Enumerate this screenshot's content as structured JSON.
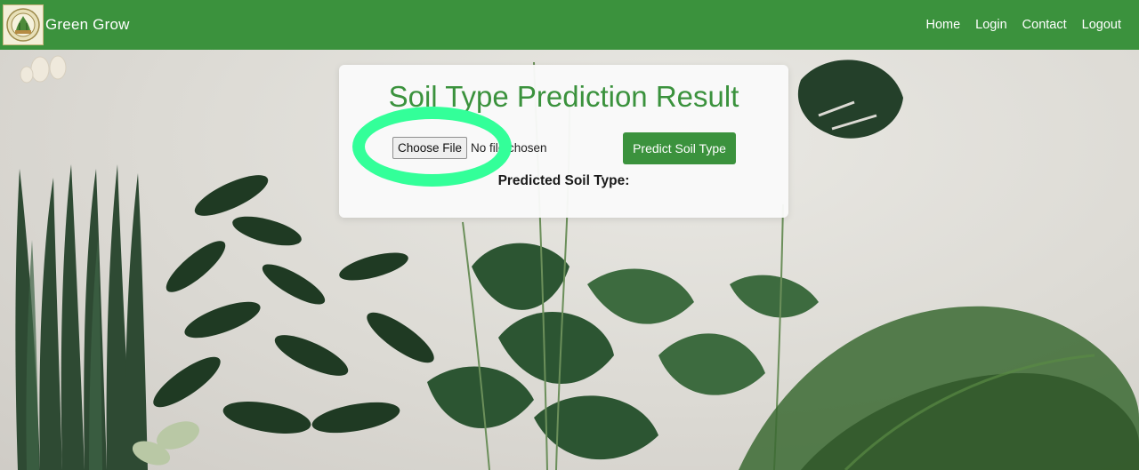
{
  "navbar": {
    "brand": "Green Grow",
    "links": [
      {
        "label": "Home"
      },
      {
        "label": "Login"
      },
      {
        "label": "Contact"
      },
      {
        "label": "Logout"
      }
    ]
  },
  "card": {
    "title": "Soil Type Prediction Result",
    "file_button": "Choose File",
    "file_status": "No file chosen",
    "predict_button": "Predict Soil Type",
    "result_label": "Predicted Soil Type:"
  },
  "colors": {
    "brand_green": "#3b923d",
    "highlight": "#33ff99"
  }
}
